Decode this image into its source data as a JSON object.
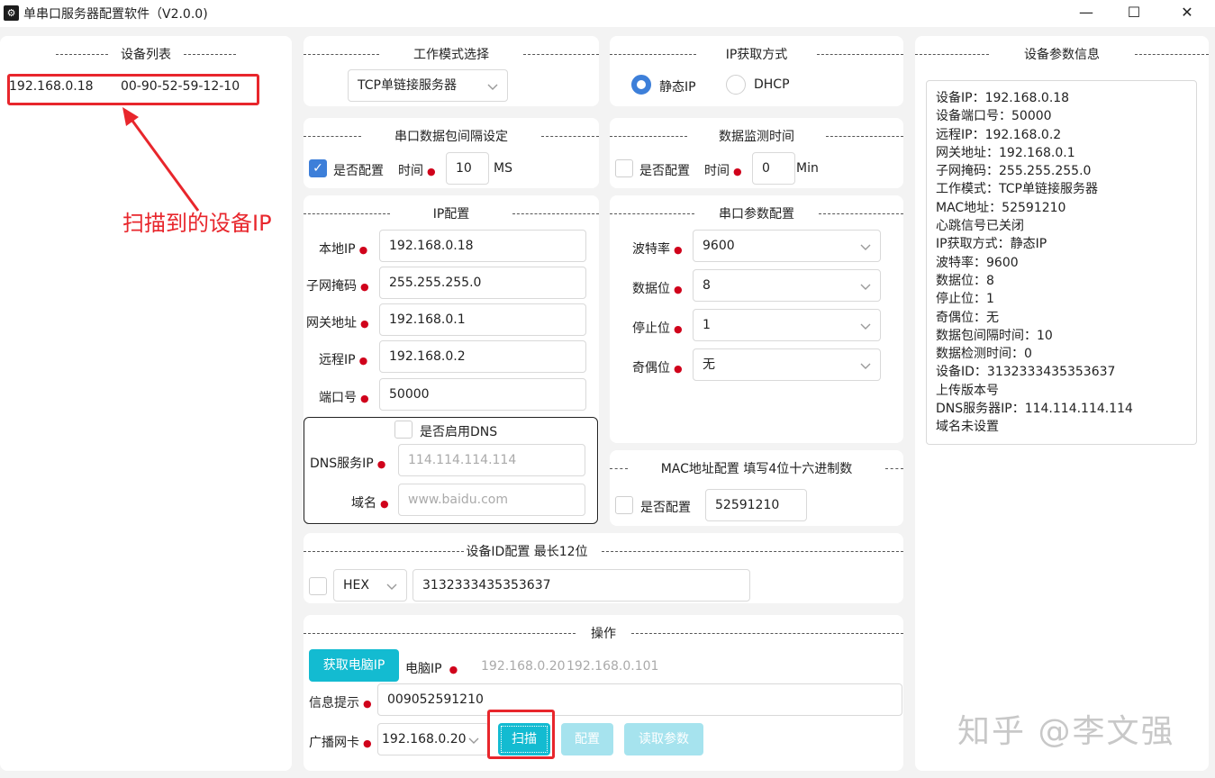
{
  "window": {
    "title": "单串口服务器配置软件（V2.0.0)",
    "app_icon": "gear-icon",
    "minimize": "—",
    "maximize": "☐",
    "close": "✕"
  },
  "device_list": {
    "legend": "设备列表",
    "items": [
      {
        "ip": "192.168.0.18",
        "mac": "00-90-52-59-12-10"
      }
    ],
    "annotation": "扫描到的设备IP"
  },
  "work_mode": {
    "legend": "工作模式选择",
    "value": "TCP单链接服务器"
  },
  "ip_mode": {
    "legend": "IP获取方式",
    "static_label": "静态IP",
    "dhcp_label": "DHCP",
    "selected": "静态IP"
  },
  "packet_interval": {
    "legend": "串口数据包间隔设定",
    "config_label": "是否配置",
    "checked": true,
    "time_label": "时间",
    "value": "10",
    "unit": "MS"
  },
  "monitor_time": {
    "legend": "数据监测时间",
    "config_label": "是否配置",
    "checked": false,
    "time_label": "时间",
    "value": "0",
    "unit": "Min"
  },
  "ip_config": {
    "legend": "IP配置",
    "fields": [
      {
        "label": "本地IP",
        "value": "192.168.0.18"
      },
      {
        "label": "子网掩码",
        "value": "255.255.255.0"
      },
      {
        "label": "网关地址",
        "value": "192.168.0.1"
      },
      {
        "label": "远程IP",
        "value": "192.168.0.2"
      },
      {
        "label": "端口号",
        "value": "50000"
      }
    ],
    "dns_enable_label": "是否启用DNS",
    "dns_server_label": "DNS服务IP",
    "dns_server_placeholder": "114.114.114.114",
    "domain_label": "域名",
    "domain_placeholder": "www.baidu.com"
  },
  "serial_config": {
    "legend": "串口参数配置",
    "fields": [
      {
        "label": "波特率",
        "value": "9600"
      },
      {
        "label": "数据位",
        "value": "8"
      },
      {
        "label": "停止位",
        "value": "1"
      },
      {
        "label": "奇偶位",
        "value": "无"
      }
    ]
  },
  "mac_config": {
    "legend": "MAC地址配置 填写4位十六进制数",
    "config_label": "是否配置",
    "value": "52591210"
  },
  "device_id": {
    "legend": "设备ID配置  最长12位",
    "format": "HEX",
    "value": "3132333435353637"
  },
  "operation": {
    "legend": "操作",
    "get_pc_ip_button": "获取电脑IP",
    "pc_ip_label": "电脑IP",
    "pc_ips": [
      "192.168.0.20",
      "192.168.0.101"
    ],
    "info_label": "信息提示",
    "info_value": "009052591210",
    "nic_label": "广播网卡",
    "nic_value": "192.168.0.20",
    "scan_button": "扫描",
    "config_button": "配置",
    "read_button": "读取参数"
  },
  "device_params": {
    "legend": "设备参数信息",
    "lines": [
      "设备IP：192.168.0.18",
      "设备端口号：50000",
      "远程IP：192.168.0.2",
      "网关地址：192.168.0.1",
      "子网掩码：255.255.255.0",
      "工作模式：TCP单链接服务器",
      "MAC地址：52591210",
      "心跳信号已关闭",
      "IP获取方式：静态IP",
      "波特率：9600",
      "数据位：8",
      "停止位：1",
      "奇偶位：无",
      "数据包间隔时间：10",
      "数据检测时间：0",
      "设备ID：3132333435353637",
      "上传版本号",
      "DNS服务器IP：114.114.114.114",
      "域名未设置"
    ]
  },
  "watermark": "知乎 @李文强",
  "colors": {
    "accent": "#13bbd1",
    "checkbox": "#3d7fd9",
    "required": "#d0021b",
    "annotation": "#e8262c"
  }
}
